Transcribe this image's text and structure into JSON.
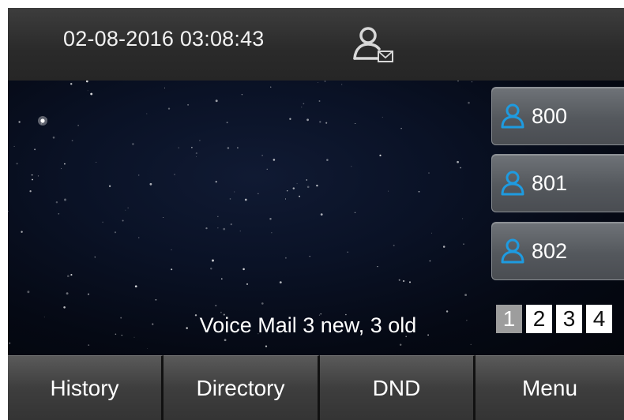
{
  "status_bar": {
    "datetime": "02-08-2016 03:08:43",
    "voicemail_icon": "contact-voicemail-icon"
  },
  "line_keys": [
    {
      "label": "800",
      "icon": "contact-icon"
    },
    {
      "label": "801",
      "icon": "contact-icon"
    },
    {
      "label": "802",
      "icon": "contact-icon"
    }
  ],
  "page_indicator": {
    "pages": [
      "1",
      "2",
      "3",
      "4"
    ],
    "active": "1"
  },
  "voicemail_message": "Voice Mail 3 new, 3 old",
  "softkeys": [
    {
      "label": "History"
    },
    {
      "label": "Directory"
    },
    {
      "label": "DND"
    },
    {
      "label": "Menu"
    }
  ],
  "colors": {
    "contact_icon": "#1e9be0",
    "page_active_bg": "#9d9d9d",
    "page_inactive_bg": "#ffffff"
  }
}
